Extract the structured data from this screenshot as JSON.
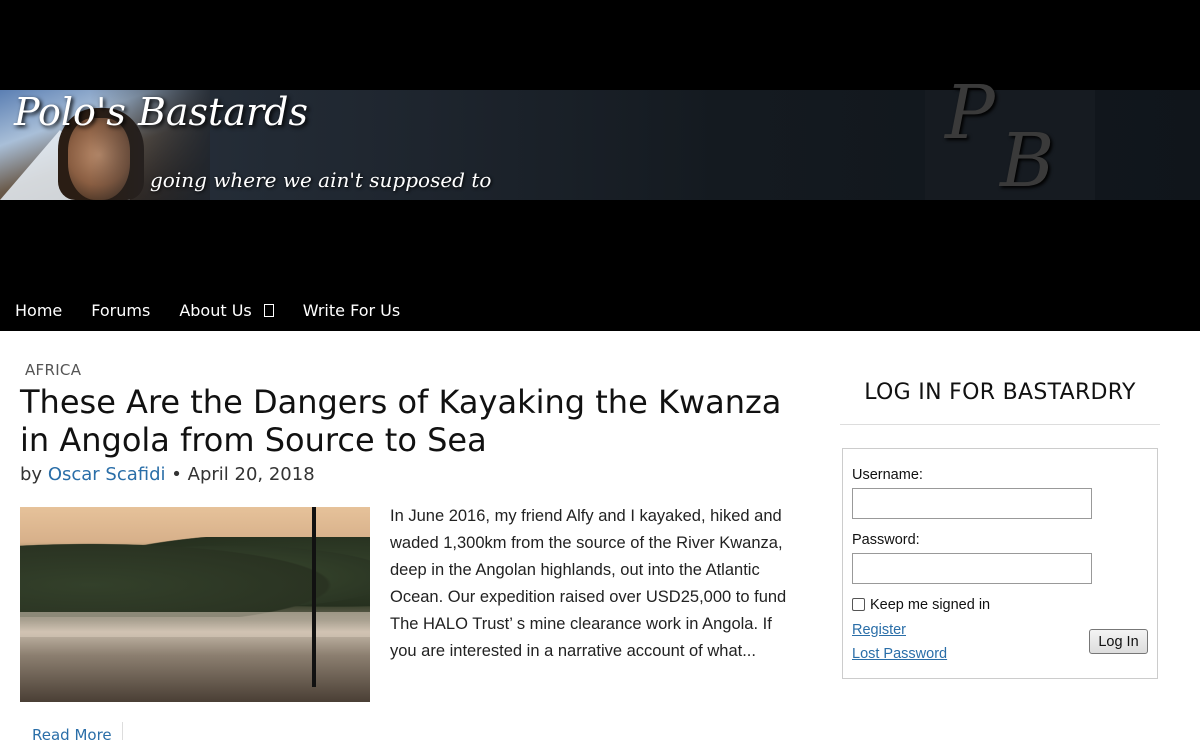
{
  "site": {
    "title": "Polo's Bastards",
    "tagline": "going where we ain't supposed to",
    "logo_letters": [
      "P",
      "B"
    ]
  },
  "nav": {
    "items": [
      {
        "label": "Home",
        "has_dropdown": false
      },
      {
        "label": "Forums",
        "has_dropdown": false
      },
      {
        "label": "About Us",
        "has_dropdown": true
      },
      {
        "label": "Write For Us",
        "has_dropdown": false
      }
    ]
  },
  "post": {
    "category": "AFRICA",
    "title": "These Are the Dangers of Kayaking the Kwanza in Angola from Source to Sea",
    "byline_prefix": "by",
    "author": "Oscar Scafidi",
    "separator": "•",
    "date": "April 20, 2018",
    "excerpt": "In June 2016, my friend Alfy and I kayaked, hiked and waded 1,300km from the source of the River Kwanza, deep in the Angolan highlands, out into the Atlantic Ocean. Our expedition raised over USD25,000 to fund The HALO Trust’ s mine clearance work in Angola. If you are interested in a narrative account of what...",
    "read_more": "Read More"
  },
  "sidebar": {
    "widget_title": "LOG IN FOR BASTARDRY",
    "username_label": "Username:",
    "username_value": "",
    "password_label": "Password:",
    "password_value": "",
    "remember_label": "Keep me signed in",
    "remember_checked": false,
    "register_link": "Register",
    "lost_password_link": "Lost Password",
    "login_button": "Log In"
  },
  "colors": {
    "link": "#2a6ea8",
    "nav_bg": "#000000",
    "header_bg": "#000000"
  }
}
